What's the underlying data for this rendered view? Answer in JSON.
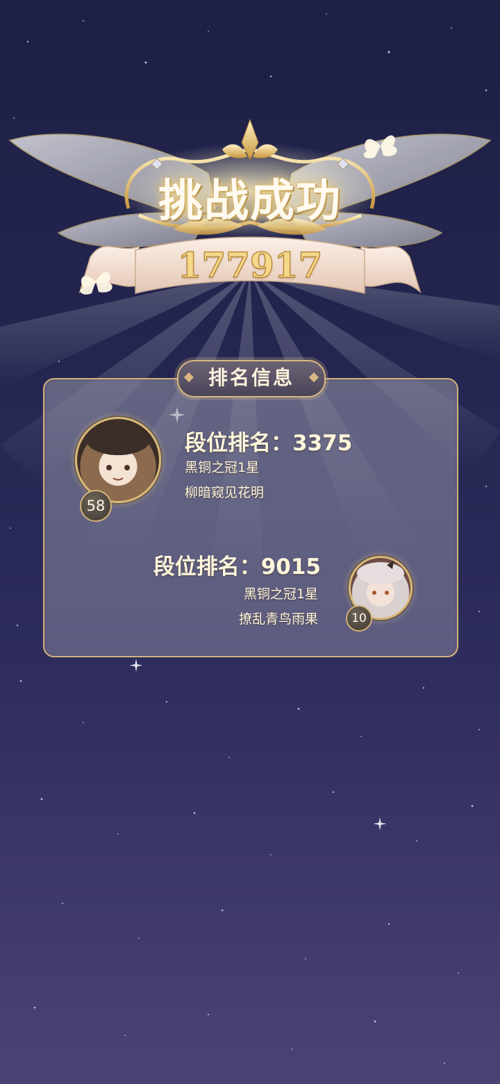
{
  "result": {
    "title": "挑战成功",
    "score": "177917"
  },
  "panel": {
    "tag": "排名信息"
  },
  "players": [
    {
      "rank_label": "段位排名：",
      "rank_value": "3375",
      "tier": "黑铜之冠1星",
      "name": "柳暗窥见花明",
      "level": "58"
    },
    {
      "rank_label": "段位排名：",
      "rank_value": "9015",
      "tier": "黑铜之冠1星",
      "name": "撩乱青鸟雨果",
      "level": "10"
    }
  ],
  "colors": {
    "accent_gold": "#d9b978",
    "text_light": "#fff6dc",
    "sky_top": "#1d1f45",
    "sky_bottom": "#4a4374"
  }
}
